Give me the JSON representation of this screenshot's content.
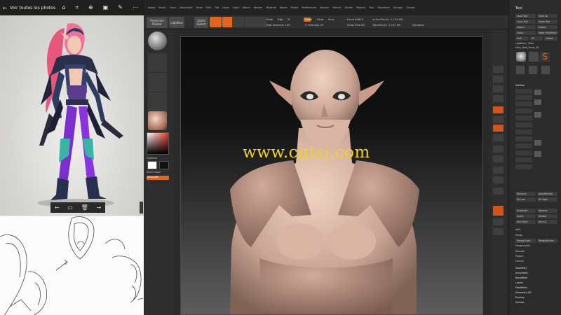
{
  "photos": {
    "title": "Voir toutes les photos",
    "tools": [
      "share-icon",
      "crop-icon",
      "zoom-icon",
      "slideshow-icon",
      "edit-icon",
      "more-icon"
    ]
  },
  "zbrush": {
    "menu": [
      "Alpha",
      "Brush",
      "Color",
      "Document",
      "Draw",
      "Edit",
      "File",
      "Layer",
      "Light",
      "Macro",
      "Marker",
      "Material",
      "Movie",
      "Picker",
      "Preferences",
      "Render",
      "Stencil",
      "Stroke",
      "Texture",
      "Tool",
      "Transform",
      "Zplugin",
      "Zscript"
    ],
    "toolbar": {
      "projection_master": "Projection Master",
      "lightbox": "LightBox",
      "quick_sketch": "Quick Sketch",
      "edit": "Edit",
      "draw": "Draw",
      "move": "Move",
      "scale": "Scale",
      "rotate": "Rotate",
      "mrgb": "Mrgb",
      "rgb": "Rgb",
      "m": "M",
      "zadd": "Zadd",
      "zsub": "Zsub",
      "zcut": "Zcut",
      "rgb_intensity": "Rgb Intensity 100",
      "z_intensity": "Z Intensity 25",
      "focal_shift": "Focal Shift 0",
      "draw_size": "Draw Size 64",
      "active_points": "ActivePoints: 1,745 Mil",
      "total_points": "TotalPoints: 1,545 Mil",
      "dynamic": "Dynamic"
    },
    "left": {
      "gradient_label": "Gradient",
      "switch_color_label": "SwitchColor",
      "alternate_label": "Alternate"
    },
    "watermark": "www.cgtsj.com",
    "tool_panel": {
      "title": "Tool",
      "load_tool": "Load Tool",
      "save_as": "Save As",
      "copy_tool": "Copy Tool",
      "paste_tool": "Paste Tool",
      "import": "Import",
      "export": "Export",
      "clone": "Clone",
      "make_polymesh": "Make PolyMesh3D",
      "goz": "GoZ",
      "all": "All",
      "visible": "Visible",
      "lightbox_tools": "Lightbox> Tools",
      "fairy": "Fairy_Base_Body_08",
      "subtool": "SubTool",
      "rename": "Rename",
      "auto_reorder": "AutoReorder",
      "all_low": "All Low",
      "all_high": "All High",
      "duplicate": "Duplicate",
      "append": "Append",
      "insert": "Insert",
      "delete": "Delete",
      "del_other": "Del Other",
      "del_all": "Del All",
      "split": "Split",
      "merge": "Merge",
      "merge_down": "MergeDown",
      "merge_similar": "MergeSimilar",
      "merge_visible": "MergeVisible",
      "remesh": "Remesh",
      "project": "Project",
      "extract": "Extract",
      "geometry": "Geometry",
      "array_mesh": "ArrayMesh",
      "nano_mesh": "NanoMesh",
      "layers": "Layers",
      "fiber_mesh": "FiberMesh",
      "geometry_hd": "Geometry HD",
      "preview": "Preview",
      "surface": "Surface"
    }
  },
  "colors": {
    "accent": "#e0651d",
    "watermark": "#f2d22a"
  }
}
